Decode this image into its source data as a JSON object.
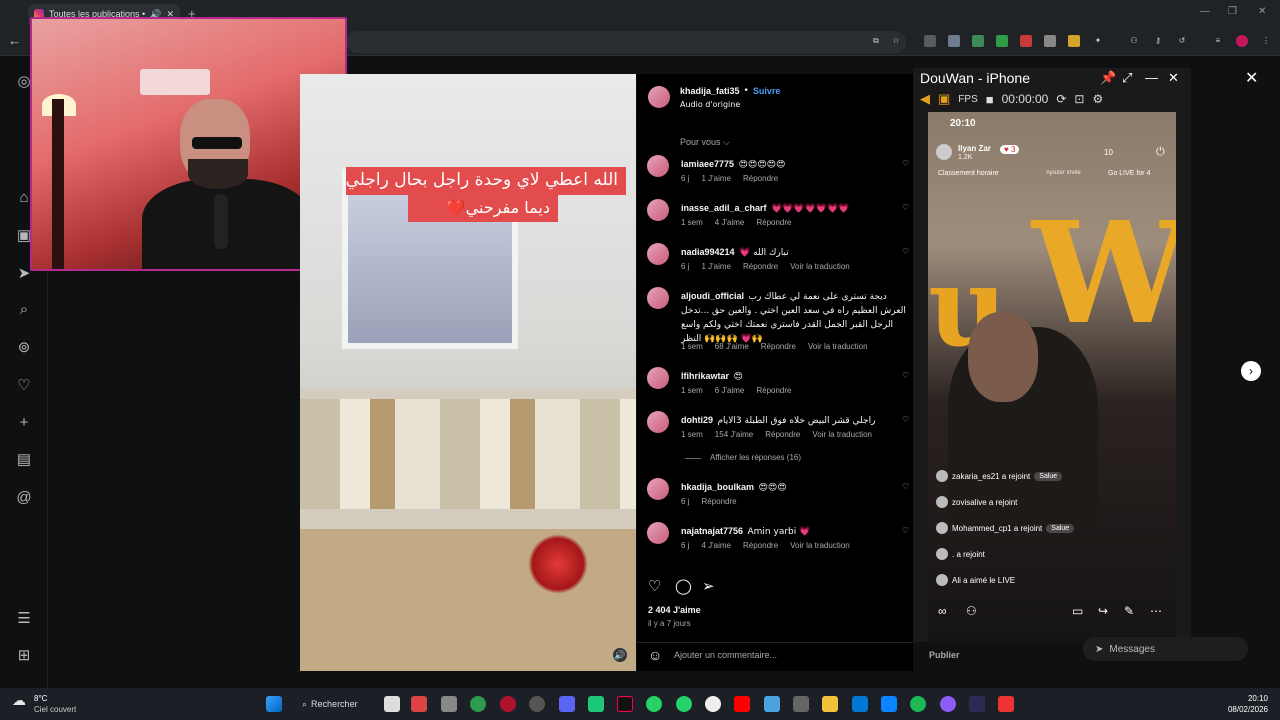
{
  "browser": {
    "tab_title": "Toutes les publications • Ins",
    "newtab_glyph": "+",
    "window_controls": [
      "—",
      "❐",
      "✕"
    ]
  },
  "post": {
    "author": "khadija_fati35",
    "dot": "•",
    "follow_label": "Suivre",
    "audio": "Audio d'origine",
    "caption_line1": "الله اعطي لاي وحدة راجل بحال راجلي",
    "caption_line2": "ديما مفرحني❤️",
    "sort_label": "Pour vous ⌵",
    "likes": "2 404 J'aime",
    "posted_ago": "il y a 7 jours",
    "add_comment_placeholder": "Ajouter un commentaire...",
    "publish_label": "Publier"
  },
  "comments": [
    {
      "user": "lamiaee7775",
      "text": "😍😍😍😍😍",
      "age": "6 j",
      "likes": "1 J'aime",
      "reply": "Répondre",
      "translate": ""
    },
    {
      "user": "inasse_adil_a_charf",
      "text": "💗💗💗💗💗💗💗",
      "age": "1 sem",
      "likes": "4 J'aime",
      "reply": "Répondre",
      "translate": ""
    },
    {
      "user": "nadia994214",
      "text": "💗 تبارك الله",
      "age": "6 j",
      "likes": "1 J'aime",
      "reply": "Répondre",
      "translate": "Voir la traduction"
    },
    {
      "user": "aljoudi_official",
      "text": "ديجة تسترى على نعمة لي عطاك رب العرش العظيم راه في سعد العين اختي . والعين حق ...تدخل الرجل القبر الجمل القدر فاستري نعمتك اختي ولكم واسع النظر 🙌🙌🙌 💗🙌",
      "age": "1 sem",
      "likes": "68 J'aime",
      "reply": "Répondre",
      "translate": "Voir la traduction"
    },
    {
      "user": "lfihrikawtar",
      "text": "😍",
      "age": "1 sem",
      "likes": "6 J'aime",
      "reply": "Répondre",
      "translate": ""
    },
    {
      "user": "dohti29",
      "text": "راجلي قشر البيض خلاه فوق الطبلة 3الايام",
      "age": "1 sem",
      "likes": "154 J'aime",
      "reply": "Répondre",
      "translate": "Voir la traduction"
    },
    {
      "user": "hkadija_boulkam",
      "text": "😍😍😍",
      "age": "6 j",
      "likes": "",
      "reply": "Répondre",
      "translate": ""
    },
    {
      "user": "najatnajat7756",
      "text": "Amin yarbi 💗",
      "age": "6 j",
      "likes": "4 J'aime",
      "reply": "Répondre",
      "translate": "Voir la traduction"
    }
  ],
  "replies_toggle": "Afficher les réponses (16)",
  "douwan": {
    "title": "DouWan - iPhone",
    "fps": "FPS",
    "timer": "00:00:00",
    "phone_time": "20:10",
    "streamer": "Ilyan Zar",
    "followers": "1.2K",
    "heart_count": "3",
    "viewers": "10",
    "ranking": "Classement horaire",
    "add_guest": "Ajouter invité",
    "go_live": "Go LIVE for 4",
    "feed": [
      {
        "text": "zakaria_es21 a rejoint",
        "pill": "Salue"
      },
      {
        "text": "zovisalive a rejoint",
        "pill": ""
      },
      {
        "text": "Mohammed_cp1 a rejoint",
        "pill": "Salue"
      },
      {
        "text": ". a rejoint",
        "pill": ""
      },
      {
        "text": "Ali a aimé le LIVE",
        "pill": ""
      }
    ],
    "logo_u": "u",
    "logo_w": "W"
  },
  "messages_label": "Messages",
  "taskbar": {
    "weather_temp": "8°C",
    "weather_desc": "Ciel couvert",
    "search_label": "Rechercher",
    "time": "20:10",
    "date": "08/02/2026"
  }
}
